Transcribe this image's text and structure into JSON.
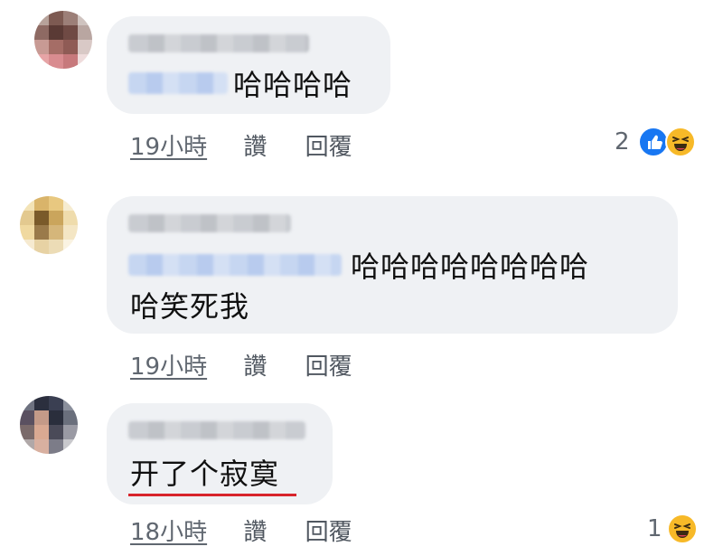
{
  "comments": [
    {
      "text": "哈哈哈哈",
      "meta": {
        "time": "19小時",
        "like": "讚",
        "reply": "回覆"
      },
      "reactions": {
        "count": "2",
        "icons": [
          "like-icon",
          "haha-icon"
        ]
      }
    },
    {
      "text_line1": "哈哈哈哈哈哈哈哈",
      "text_line2": "哈笑死我",
      "meta": {
        "time": "19小時",
        "like": "讚",
        "reply": "回覆"
      }
    },
    {
      "text": "开了个寂寞",
      "highlight_color": "#d8242b",
      "meta": {
        "time": "18小時",
        "like": "讚",
        "reply": "回覆"
      },
      "reactions": {
        "count": "1",
        "icons": [
          "haha-icon"
        ]
      }
    }
  ],
  "colors": {
    "bubble": "#eff1f4",
    "meta": "#606770",
    "like_blue": "#1877f2",
    "haha_yellow": "#f7b928"
  }
}
